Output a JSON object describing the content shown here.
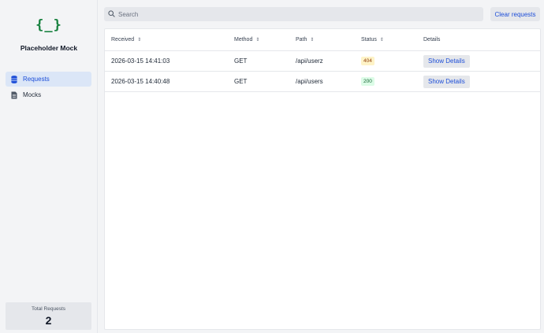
{
  "app": {
    "logo": "{_}",
    "title": "Placeholder Mock"
  },
  "sidebar": {
    "items": [
      {
        "label": "Requests",
        "icon": "database-icon",
        "active": true
      },
      {
        "label": "Mocks",
        "icon": "document-icon",
        "active": false
      }
    ],
    "stats": {
      "label": "Total Requests",
      "value": "2"
    }
  },
  "search": {
    "placeholder": "Search",
    "value": ""
  },
  "toolbar": {
    "clear_label": "Clear requests"
  },
  "table": {
    "columns": [
      "Received",
      "Method",
      "Path",
      "Status",
      "Details"
    ],
    "rows": [
      {
        "received": "2026-03-15 14:41:03",
        "method": "GET",
        "path": "/api/userz",
        "status": "404",
        "details": "Show Details"
      },
      {
        "received": "2026-03-15 14:40:48",
        "method": "GET",
        "path": "/api/users",
        "status": "200",
        "details": "Show Details"
      }
    ]
  },
  "colors": {
    "accent": "#1d4ed8",
    "logo": "#15803d",
    "status_404_bg": "#fef3c7",
    "status_200_bg": "#dcfce7"
  }
}
